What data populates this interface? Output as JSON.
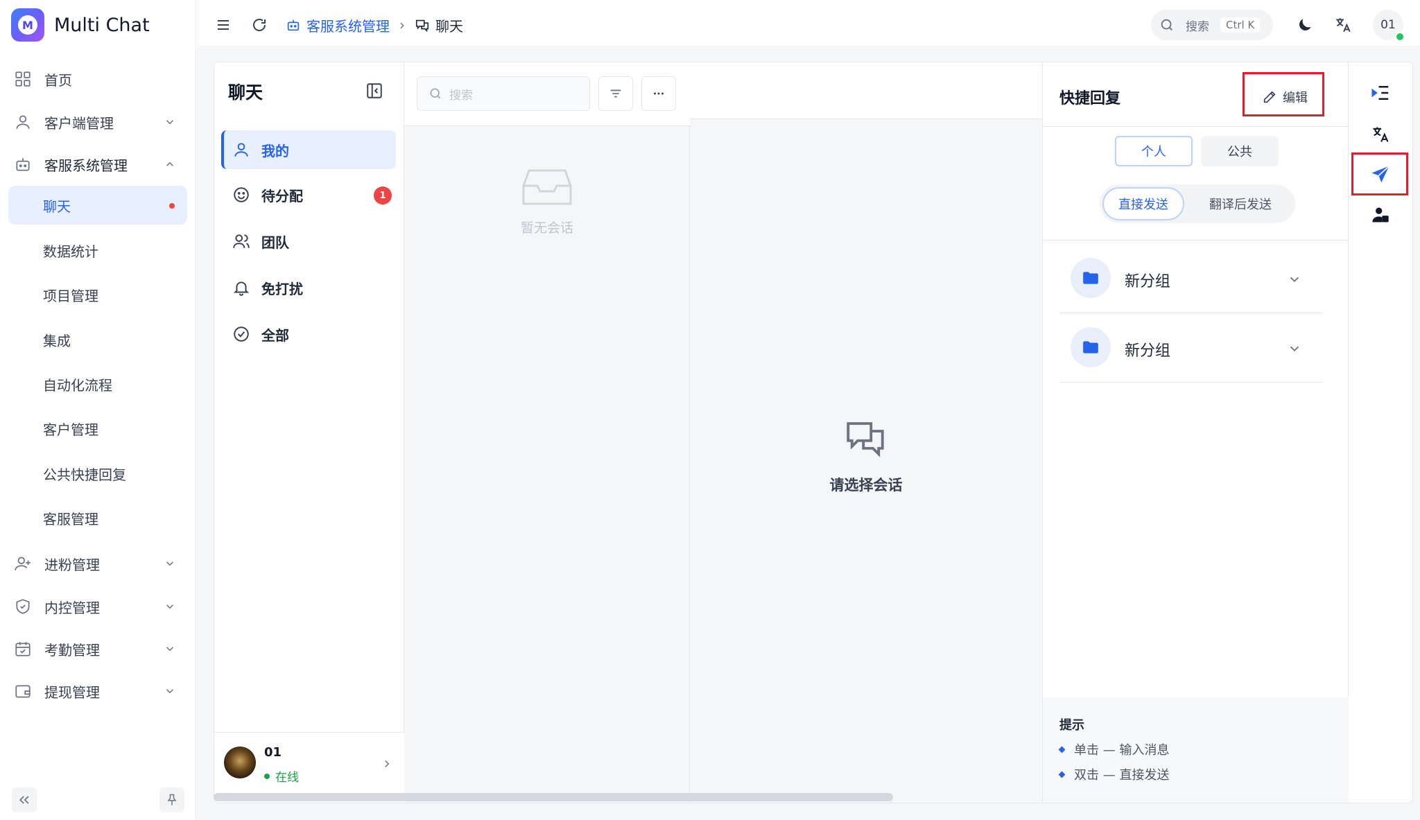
{
  "app": {
    "name": "Multi Chat",
    "logo_letter": "M"
  },
  "sidebar": {
    "items": [
      {
        "label": "首页",
        "icon": "grid-icon"
      },
      {
        "label": "客户端管理",
        "icon": "user-icon",
        "expandable": true
      },
      {
        "label": "客服系统管理",
        "icon": "robot-icon",
        "expandable": true,
        "expanded": true
      },
      {
        "label": "聊天",
        "sub": true,
        "active": true,
        "dot": true
      },
      {
        "label": "数据统计",
        "sub": true
      },
      {
        "label": "项目管理",
        "sub": true
      },
      {
        "label": "集成",
        "sub": true
      },
      {
        "label": "自动化流程",
        "sub": true
      },
      {
        "label": "客户管理",
        "sub": true
      },
      {
        "label": "公共快捷回复",
        "sub": true
      },
      {
        "label": "客服管理",
        "sub": true
      },
      {
        "label": "进粉管理",
        "icon": "user-plus-icon",
        "expandable": true
      },
      {
        "label": "内控管理",
        "icon": "shield-icon",
        "expandable": true
      },
      {
        "label": "考勤管理",
        "icon": "calendar-check-icon",
        "expandable": true
      },
      {
        "label": "提现管理",
        "icon": "wallet-icon",
        "expandable": true
      }
    ]
  },
  "header": {
    "breadcrumb_parent": "客服系统管理",
    "breadcrumb_current": "聊天",
    "search_label": "搜索",
    "search_shortcut": "Ctrl K",
    "user_initials": "01"
  },
  "chat_nav": {
    "title": "聊天",
    "items": [
      {
        "label": "我的",
        "icon": "user-icon",
        "active": true
      },
      {
        "label": "待分配",
        "icon": "smile-icon",
        "badge": "1"
      },
      {
        "label": "团队",
        "icon": "users-icon"
      },
      {
        "label": "免打扰",
        "icon": "bell-icon"
      },
      {
        "label": "全部",
        "icon": "check-circle-icon"
      }
    ],
    "user": {
      "name": "01",
      "status": "在线"
    }
  },
  "conversation_list": {
    "search_placeholder": "搜索",
    "empty_text": "暂无会话"
  },
  "center": {
    "placeholder_text": "请选择会话"
  },
  "quick_reply": {
    "title": "快捷回复",
    "edit_label": "编辑",
    "scope_tabs": [
      {
        "label": "个人",
        "active": true
      },
      {
        "label": "公共",
        "active": false
      }
    ],
    "send_tabs": [
      {
        "label": "直接发送",
        "active": true
      },
      {
        "label": "翻译后发送",
        "active": false
      }
    ],
    "groups": [
      {
        "name": "新分组"
      },
      {
        "name": "新分组"
      }
    ],
    "tips_title": "提示",
    "tips": [
      "单击 — 输入消息",
      "双击 — 直接发送"
    ]
  },
  "colors": {
    "accent": "#2563eb",
    "highlight": "#e11d2e",
    "online": "#22c55e",
    "badge": "#ef4444"
  }
}
